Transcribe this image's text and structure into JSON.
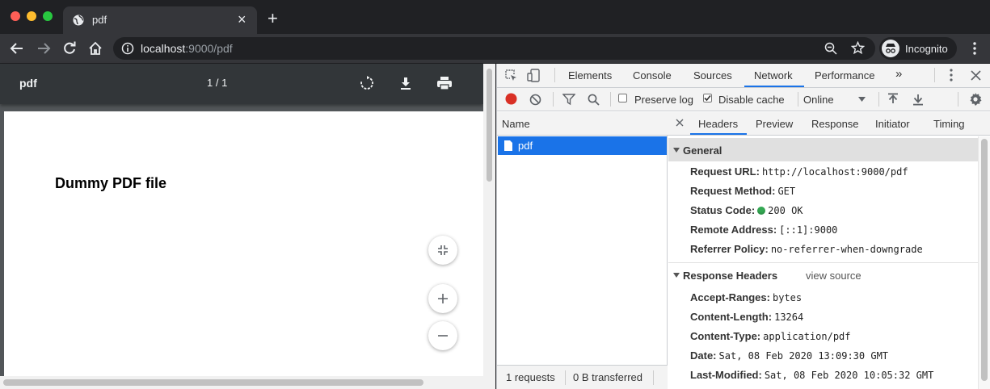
{
  "browser": {
    "tab": {
      "title": "pdf",
      "close": "×"
    },
    "new_tab": "+",
    "url": {
      "host": "localhost",
      "rest": ":9000/pdf"
    },
    "profile_label": "Incognito"
  },
  "pdf_viewer": {
    "title": "pdf",
    "page_indicator": "1 / 1",
    "page_text": "Dummy PDF file"
  },
  "devtools": {
    "tabs": [
      "Elements",
      "Console",
      "Sources",
      "Network",
      "Performance"
    ],
    "active_tab": "Network",
    "more_tabs": "»",
    "network_toolbar": {
      "preserve_log": "Preserve log",
      "preserve_log_checked": false,
      "disable_cache": "Disable cache",
      "disable_cache_checked": true,
      "throttling": "Online"
    },
    "request_list": {
      "header": "Name",
      "requests": [
        {
          "name": "pdf",
          "selected": true
        }
      ],
      "footer": {
        "requests": "1 requests",
        "transferred": "0 B transferred"
      }
    },
    "details": {
      "close": "×",
      "tabs": [
        "Headers",
        "Preview",
        "Response",
        "Initiator",
        "Timing"
      ],
      "active_tab": "Headers",
      "general": {
        "title": "General",
        "rows": [
          {
            "key": "Request URL:",
            "value": "http://localhost:9000/pdf"
          },
          {
            "key": "Request Method:",
            "value": "GET"
          },
          {
            "key": "Status Code:",
            "value": "200 OK",
            "status_color": "#34a853"
          },
          {
            "key": "Remote Address:",
            "value": "[::1]:9000"
          },
          {
            "key": "Referrer Policy:",
            "value": "no-referrer-when-downgrade"
          }
        ]
      },
      "response_headers": {
        "title": "Response Headers",
        "view_source": "view source",
        "rows": [
          {
            "key": "Accept-Ranges:",
            "value": "bytes"
          },
          {
            "key": "Content-Length:",
            "value": "13264"
          },
          {
            "key": "Content-Type:",
            "value": "application/pdf"
          },
          {
            "key": "Date:",
            "value": "Sat, 08 Feb 2020 13:09:30 GMT"
          },
          {
            "key": "Last-Modified:",
            "value": "Sat, 08 Feb 2020 10:05:32 GMT"
          }
        ]
      }
    }
  },
  "colors": {
    "accent": "#1a73e8",
    "record_red": "#d93025",
    "status_green": "#34a853"
  }
}
